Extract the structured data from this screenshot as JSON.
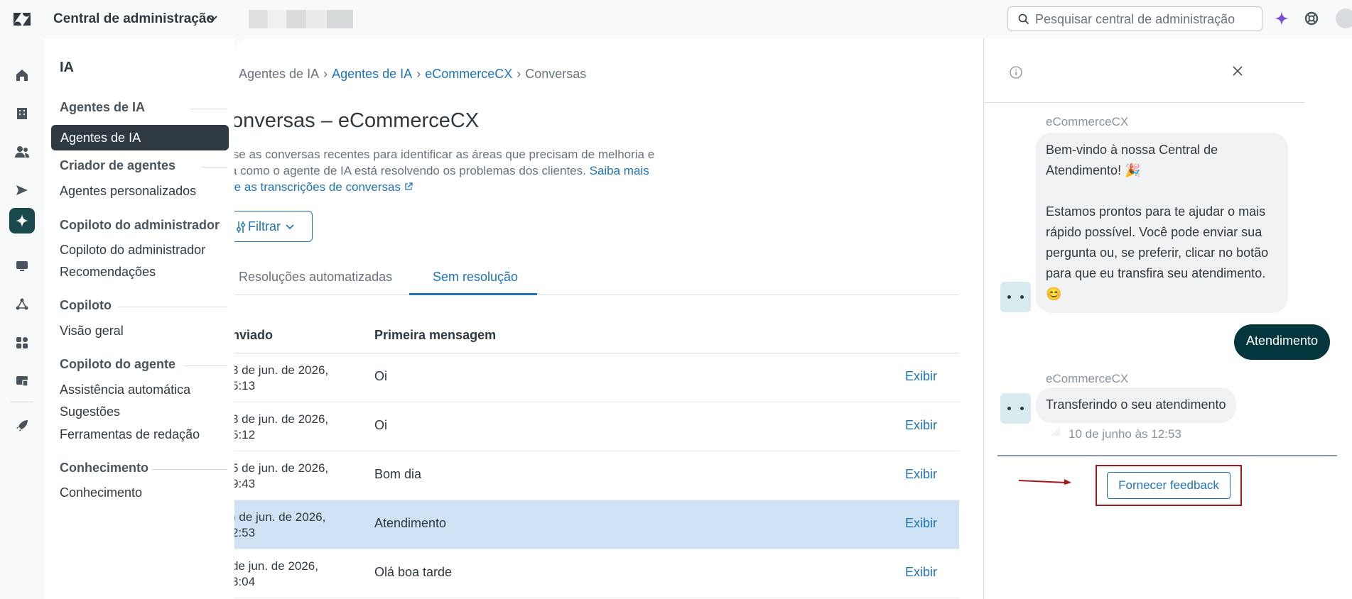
{
  "header": {
    "app_title": "Central de administração",
    "search_placeholder": "Pesquisar central de administração"
  },
  "nav": {
    "title": "IA",
    "sections": [
      {
        "label": "Agentes de IA",
        "items": [
          "Agentes de IA"
        ]
      },
      {
        "label": "Criador de agentes",
        "items": [
          "Agentes personalizados"
        ]
      },
      {
        "label": "Copiloto do administrador",
        "items": [
          "Copiloto do administrador",
          "Recomendações"
        ]
      },
      {
        "label": "Copiloto",
        "items": [
          "Visão geral"
        ]
      },
      {
        "label": "Copiloto do agente",
        "items": [
          "Assistência automática",
          "Sugestões",
          "Ferramentas de redação"
        ]
      },
      {
        "label": "Conhecimento",
        "items": [
          "Conhecimento"
        ]
      }
    ],
    "selected": "Agentes de IA"
  },
  "main": {
    "breadcrumb": [
      "Agentes de IA",
      "Agentes de IA",
      "eCommerceCX",
      "Conversas"
    ],
    "title": "onversas – eCommerceCX",
    "description_1": "ise as conversas recentes para identificar as áreas que precisam de melhoria e",
    "description_2": "a como o agente de IA está resolvendo os problemas dos clientes.",
    "learn_more_1": "Saiba mais",
    "learn_more_2": "re as transcrições de conversas",
    "filter_label": "Filtrar",
    "tabs": [
      "Resoluções automatizadas",
      "Sem resolução"
    ],
    "active_tab": "Sem resolução",
    "columns": {
      "sent": "nviado",
      "first_message": "Primeira mensagem"
    },
    "rows": [
      {
        "date_1": "3 de jun. de 2026,",
        "date_2": "5:13",
        "message": "Oi",
        "action": "Exibir"
      },
      {
        "date_1": "3 de jun. de 2026,",
        "date_2": "5:12",
        "message": "Oi",
        "action": "Exibir"
      },
      {
        "date_1": "5 de jun. de 2026,",
        "date_2": "9:43",
        "message": "Bom dia",
        "action": "Exibir"
      },
      {
        "date_1": ") de jun. de 2026,",
        "date_2": "2:53",
        "message": "Atendimento",
        "action": "Exibir"
      },
      {
        "date_1": "de jun. de 2026,",
        "date_2": "3:04",
        "message": "Olá boa tarde",
        "action": "Exibir"
      }
    ]
  },
  "conversation": {
    "sender_1": "eCommerceCX",
    "bot_message_1_a": "Bem-vindo à nossa Central de Atendimento! 🎉",
    "bot_message_1_b": "Estamos prontos para te ajudar o mais rápido possível. Você pode enviar sua pergunta ou, se preferir, clicar no botão para que eu transfira seu atendimento. 😊",
    "user_message": "Atendimento",
    "sender_2": "eCommerceCX",
    "bot_message_2": "Transferindo o seu atendimento",
    "timestamp": "10 de junho às 12:53",
    "feedback_label": "Fornecer feedback"
  },
  "colors": {
    "accent": "#1f73b7",
    "dark_nav": "#2f3941",
    "brand_dark": "#03363d",
    "highlight_row": "#cfe2f3",
    "annotation_red": "#a31919"
  }
}
